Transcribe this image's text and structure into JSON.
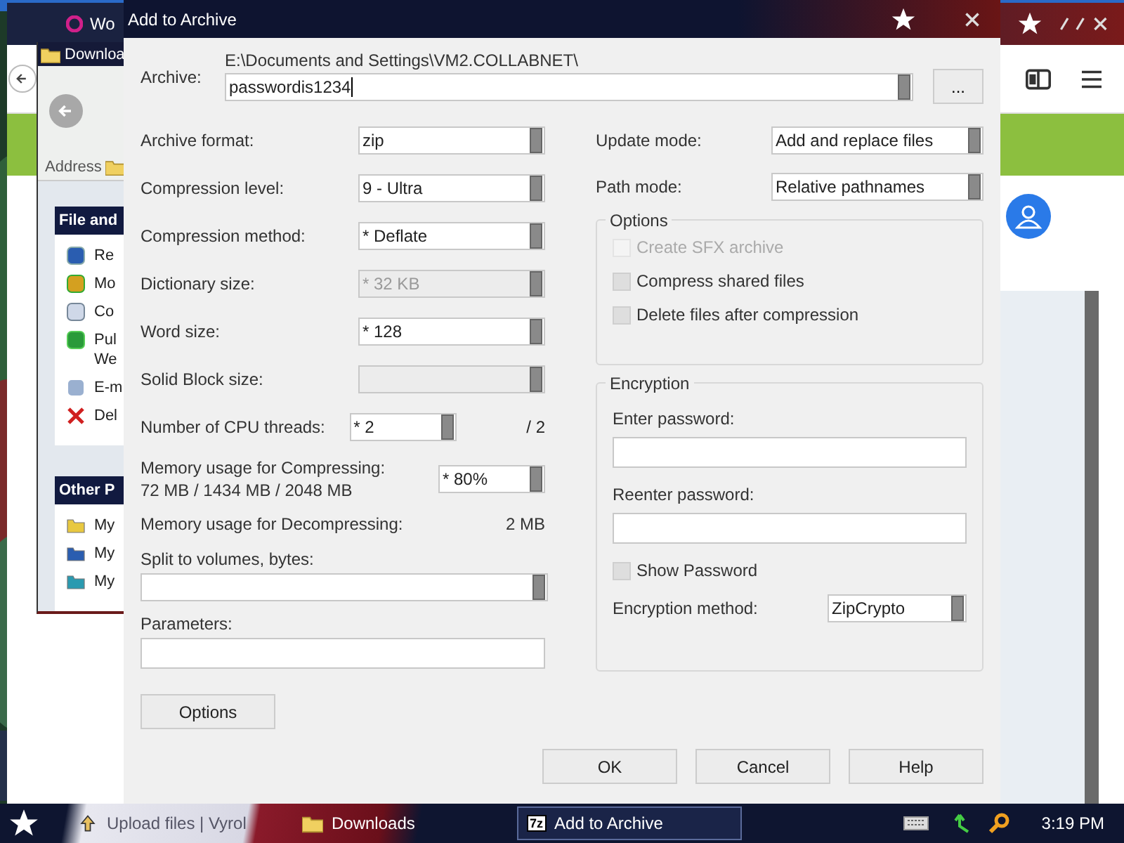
{
  "browser": {
    "tab_title": "Wo"
  },
  "explorer": {
    "title": "Downloa",
    "address_label": "Address",
    "task_panels": [
      {
        "title": "File and",
        "items": [
          {
            "text": "Re"
          },
          {
            "text": "Mo"
          },
          {
            "text": "Co"
          },
          {
            "text": "Pul\nWe"
          },
          {
            "text": "E-m"
          },
          {
            "text": "Del"
          }
        ]
      },
      {
        "title": "Other P",
        "items": [
          {
            "text": "My"
          },
          {
            "text": "My"
          },
          {
            "text": "My"
          }
        ]
      }
    ]
  },
  "dialog": {
    "title": "Add to Archive",
    "archive_label": "Archive:",
    "archive_path": "E:\\Documents and Settings\\VM2.COLLABNET\\",
    "archive_name": "passwordis1234",
    "browse": "...",
    "left_rows": [
      {
        "kind": "combo",
        "label": "Archive format:",
        "value": "zip",
        "disabled": false
      },
      {
        "kind": "combo",
        "label": "Compression level:",
        "value": "9 - Ultra",
        "disabled": false
      },
      {
        "kind": "combo",
        "label": "Compression method:",
        "value": "* Deflate",
        "disabled": false
      },
      {
        "kind": "combo",
        "label": "Dictionary size:",
        "value": "* 32 KB",
        "disabled": true
      },
      {
        "kind": "combo",
        "label": "Word size:",
        "value": "* 128",
        "disabled": false
      },
      {
        "kind": "combo",
        "label": "Solid Block size:",
        "disabled": true
      },
      {
        "kind": "threads",
        "label": "Number of CPU threads:",
        "value": "* 2",
        "suffix": "/ 2"
      },
      {
        "kind": "memory",
        "label": "Memory usage for Compressing:",
        "detail": "72 MB / 1434 MB / 2048 MB",
        "value": "* 80%"
      },
      {
        "kind": "info",
        "label": "Memory usage for Decompressing:",
        "value": "2 MB"
      },
      {
        "kind": "wide_combo",
        "label": "Split to volumes, bytes:"
      },
      {
        "kind": "text",
        "label": "Parameters:"
      }
    ],
    "right_rows": [
      {
        "label": "Update mode:",
        "value": "Add and replace files"
      },
      {
        "label": "Path mode:",
        "value": "Relative pathnames"
      }
    ],
    "options": {
      "title": "Options",
      "checkboxes": [
        {
          "label": "Create SFX archive",
          "checked": false,
          "disabled": true
        },
        {
          "label": "Compress shared files",
          "checked": false,
          "disabled": false
        },
        {
          "label": "Delete files after compression",
          "checked": false,
          "disabled": false
        }
      ]
    },
    "encryption": {
      "title": "Encryption",
      "password_label": "Enter password:",
      "reenter_label": "Reenter password:",
      "show_password": {
        "label": "Show Password",
        "checked": false
      },
      "method_label": "Encryption method:",
      "method": "ZipCrypto"
    },
    "options_button": "Options",
    "buttons": [
      "OK",
      "Cancel",
      "Help"
    ]
  },
  "taskbar": {
    "items": [
      {
        "label": "Upload files | Vyrol",
        "selected": false
      },
      {
        "label": "Downloads",
        "selected": false
      },
      {
        "label": "Add to Archive",
        "badge": "7z",
        "selected": true
      }
    ],
    "clock": "3:19 PM"
  }
}
